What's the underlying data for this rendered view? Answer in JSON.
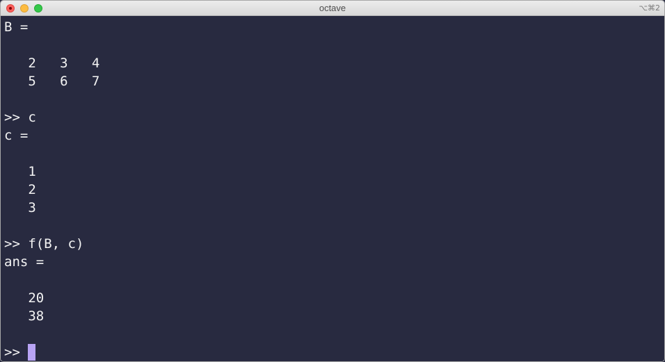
{
  "window": {
    "title": "octave",
    "shortcut": "⌥⌘2"
  },
  "terminal": {
    "lines": [
      "B =",
      "",
      "   2   3   4",
      "   5   6   7",
      "",
      ">> c",
      "c =",
      "",
      "   1",
      "   2",
      "   3",
      "",
      ">> f(B, c)",
      "ans =",
      "",
      "   20",
      "   38",
      ""
    ],
    "prompt": ">>"
  }
}
